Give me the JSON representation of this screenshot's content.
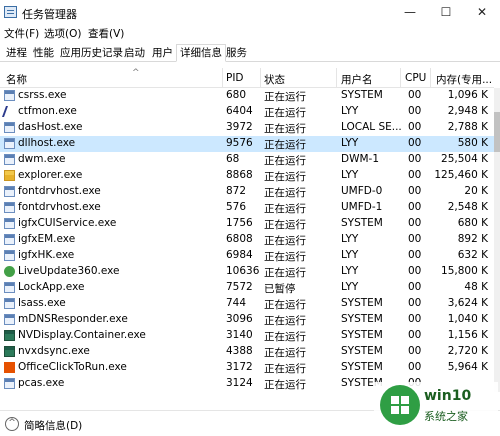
{
  "window": {
    "title": "任务管理器",
    "controls": {
      "minimize": "—",
      "maximize": "☐",
      "close": "✕"
    }
  },
  "menu": [
    "文件(F)",
    "选项(O)",
    "查看(V)"
  ],
  "tabs": [
    "进程",
    "性能",
    "应用历史记录",
    "启动",
    "用户",
    "详细信息",
    "服务"
  ],
  "active_tab": "详细信息",
  "columns": {
    "name": "名称",
    "pid": "PID",
    "status": "状态",
    "user": "用户名",
    "cpu": "CPU",
    "mem": "内存(专用..."
  },
  "processes": [
    {
      "name": "csrss.exe",
      "pid": "680",
      "status": "正在运行",
      "user": "SYSTEM",
      "cpu": "00",
      "mem": "1,096 K",
      "icon": "window-icon"
    },
    {
      "name": "ctfmon.exe",
      "pid": "6404",
      "status": "正在运行",
      "user": "LYY",
      "cpu": "00",
      "mem": "2,948 K",
      "icon": "pen-icon"
    },
    {
      "name": "dasHost.exe",
      "pid": "3972",
      "status": "正在运行",
      "user": "LOCAL SE...",
      "cpu": "00",
      "mem": "2,788 K",
      "icon": "window-icon"
    },
    {
      "name": "dllhost.exe",
      "pid": "9576",
      "status": "正在运行",
      "user": "LYY",
      "cpu": "00",
      "mem": "580 K",
      "icon": "window-icon",
      "selected": true
    },
    {
      "name": "dwm.exe",
      "pid": "68",
      "status": "正在运行",
      "user": "DWM-1",
      "cpu": "00",
      "mem": "25,504 K",
      "icon": "window-icon"
    },
    {
      "name": "explorer.exe",
      "pid": "8868",
      "status": "正在运行",
      "user": "LYY",
      "cpu": "00",
      "mem": "125,460 K",
      "icon": "folder-icon"
    },
    {
      "name": "fontdrvhost.exe",
      "pid": "872",
      "status": "正在运行",
      "user": "UMFD-0",
      "cpu": "00",
      "mem": "20 K",
      "icon": "window-icon"
    },
    {
      "name": "fontdrvhost.exe",
      "pid": "576",
      "status": "正在运行",
      "user": "UMFD-1",
      "cpu": "00",
      "mem": "2,548 K",
      "icon": "window-icon"
    },
    {
      "name": "igfxCUIService.exe",
      "pid": "1756",
      "status": "正在运行",
      "user": "SYSTEM",
      "cpu": "00",
      "mem": "680 K",
      "icon": "window-icon"
    },
    {
      "name": "igfxEM.exe",
      "pid": "6808",
      "status": "正在运行",
      "user": "LYY",
      "cpu": "00",
      "mem": "892 K",
      "icon": "window-icon"
    },
    {
      "name": "igfxHK.exe",
      "pid": "6984",
      "status": "正在运行",
      "user": "LYY",
      "cpu": "00",
      "mem": "632 K",
      "icon": "window-icon"
    },
    {
      "name": "LiveUpdate360.exe",
      "pid": "10636",
      "status": "正在运行",
      "user": "LYY",
      "cpu": "00",
      "mem": "15,800 K",
      "icon": "green-circle-icon"
    },
    {
      "name": "LockApp.exe",
      "pid": "7572",
      "status": "已暂停",
      "user": "LYY",
      "cpu": "00",
      "mem": "48 K",
      "icon": "window-icon"
    },
    {
      "name": "lsass.exe",
      "pid": "744",
      "status": "正在运行",
      "user": "SYSTEM",
      "cpu": "00",
      "mem": "3,624 K",
      "icon": "window-icon"
    },
    {
      "name": "mDNSResponder.exe",
      "pid": "3096",
      "status": "正在运行",
      "user": "SYSTEM",
      "cpu": "00",
      "mem": "1,040 K",
      "icon": "window-icon"
    },
    {
      "name": "NVDisplay.Container.exe",
      "pid": "3140",
      "status": "正在运行",
      "user": "SYSTEM",
      "cpu": "00",
      "mem": "1,156 K",
      "icon": "nvidia-icon"
    },
    {
      "name": "nvxdsync.exe",
      "pid": "4388",
      "status": "正在运行",
      "user": "SYSTEM",
      "cpu": "00",
      "mem": "2,720 K",
      "icon": "nvidia-icon"
    },
    {
      "name": "OfficeClickToRun.exe",
      "pid": "3172",
      "status": "正在运行",
      "user": "SYSTEM",
      "cpu": "00",
      "mem": "5,964 K",
      "icon": "office-icon"
    },
    {
      "name": "pcas.exe",
      "pid": "3124",
      "status": "正在运行",
      "user": "SYSTEM",
      "cpu": "00",
      "mem": "",
      "icon": "window-icon"
    }
  ],
  "footer": {
    "label": "简略信息(D)"
  },
  "watermark": {
    "brand": "win10",
    "site": "系统之家"
  }
}
